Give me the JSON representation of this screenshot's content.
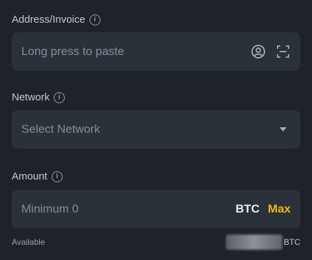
{
  "address": {
    "label": "Address/Invoice",
    "placeholder": "Long press to paste",
    "icons": [
      "contact-icon",
      "scan-icon"
    ]
  },
  "network": {
    "label": "Network",
    "placeholder": "Select Network"
  },
  "amount": {
    "label": "Amount",
    "placeholder": "Minimum 0",
    "unit": "BTC",
    "max_label": "Max"
  },
  "available": {
    "label": "Available",
    "unit": "BTC"
  },
  "colors": {
    "background": "#1e2329",
    "field": "#2b3139",
    "accent": "#f0b90b"
  }
}
